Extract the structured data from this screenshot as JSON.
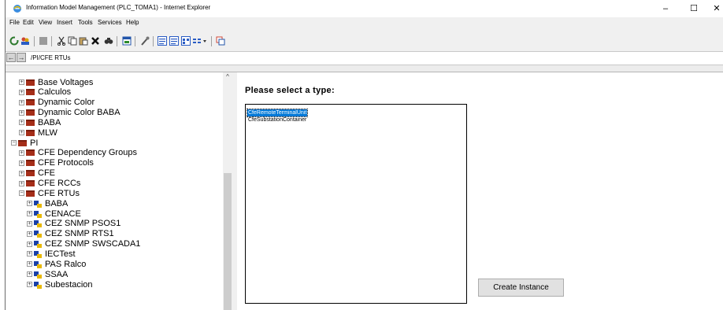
{
  "window": {
    "title": "Information Model Management (PLC_TOMA1) - Internet Explorer",
    "minimize_glyph": "–",
    "maximize_glyph": "☐",
    "close_glyph": "✕"
  },
  "menubar": {
    "items": [
      {
        "label": "File"
      },
      {
        "label": "Edit"
      },
      {
        "label": "View"
      },
      {
        "label": "Insert"
      },
      {
        "label": "Tools"
      },
      {
        "label": "Services"
      },
      {
        "label": "Help"
      }
    ]
  },
  "address": {
    "path": "/PI/CFE RTUs",
    "back_glyph": "←",
    "forward_glyph": "→"
  },
  "tree": {
    "scroll_up_glyph": "^",
    "items": [
      {
        "label": "Base Voltages",
        "expander": "+",
        "kind": "folder",
        "level": 1
      },
      {
        "label": "Calculos",
        "expander": "+",
        "kind": "folder",
        "level": 1
      },
      {
        "label": "Dynamic Color",
        "expander": "+",
        "kind": "folder",
        "level": 1
      },
      {
        "label": "Dynamic Color BABA",
        "expander": "+",
        "kind": "folder",
        "level": 1
      },
      {
        "label": "BABA",
        "expander": "+",
        "kind": "folder",
        "level": 1
      },
      {
        "label": "MLW",
        "expander": "+",
        "kind": "folder",
        "level": 1
      },
      {
        "label": "PI",
        "expander": "−",
        "kind": "folder",
        "level": 0
      },
      {
        "label": "CFE Dependency Groups",
        "expander": "+",
        "kind": "folder",
        "level": 1
      },
      {
        "label": "CFE Protocols",
        "expander": "+",
        "kind": "folder",
        "level": 1
      },
      {
        "label": "CFE",
        "expander": "+",
        "kind": "folder",
        "level": 1
      },
      {
        "label": "CFE RCCs",
        "expander": "+",
        "kind": "folder",
        "level": 1
      },
      {
        "label": "CFE RTUs",
        "expander": "−",
        "kind": "folder",
        "level": 1
      },
      {
        "label": "BABA",
        "expander": "+",
        "kind": "rtu",
        "level": 2
      },
      {
        "label": "CENACE",
        "expander": "+",
        "kind": "rtu",
        "level": 2
      },
      {
        "label": "CEZ SNMP PSOS1",
        "expander": "+",
        "kind": "rtu",
        "level": 2
      },
      {
        "label": "CEZ SNMP RTS1",
        "expander": "+",
        "kind": "rtu",
        "level": 2
      },
      {
        "label": "CEZ SNMP SWSCADA1",
        "expander": "+",
        "kind": "rtu",
        "level": 2
      },
      {
        "label": "IECTest",
        "expander": "+",
        "kind": "rtu",
        "level": 2
      },
      {
        "label": "PAS Ralco",
        "expander": "+",
        "kind": "rtu",
        "level": 2
      },
      {
        "label": "SSAA",
        "expander": "+",
        "kind": "rtu",
        "level": 2
      },
      {
        "label": "Subestacion",
        "expander": "+",
        "kind": "rtu",
        "level": 2
      }
    ]
  },
  "content": {
    "prompt": "Please select a type:",
    "types": [
      {
        "label": "CfeRemoteTerminalUnit",
        "selected": true
      },
      {
        "label": "CfeSubstationContainer",
        "selected": false
      }
    ],
    "create_button": "Create Instance"
  },
  "colors": {
    "folder": "#a52d18",
    "selection": "#0078d7",
    "rtu_icon_blue": "#1a3fa8",
    "rtu_icon_yellow": "#e8b800"
  },
  "icons": {
    "toolbar": [
      "refresh-icon",
      "users-icon",
      "stop-icon",
      "cut-icon",
      "copy-icon",
      "paste-icon",
      "delete-icon",
      "find-icon",
      "window-icon",
      "tools-icon",
      "view-icon",
      "view-icon",
      "view-icon",
      "details-view-icon",
      "settings-icon"
    ]
  }
}
